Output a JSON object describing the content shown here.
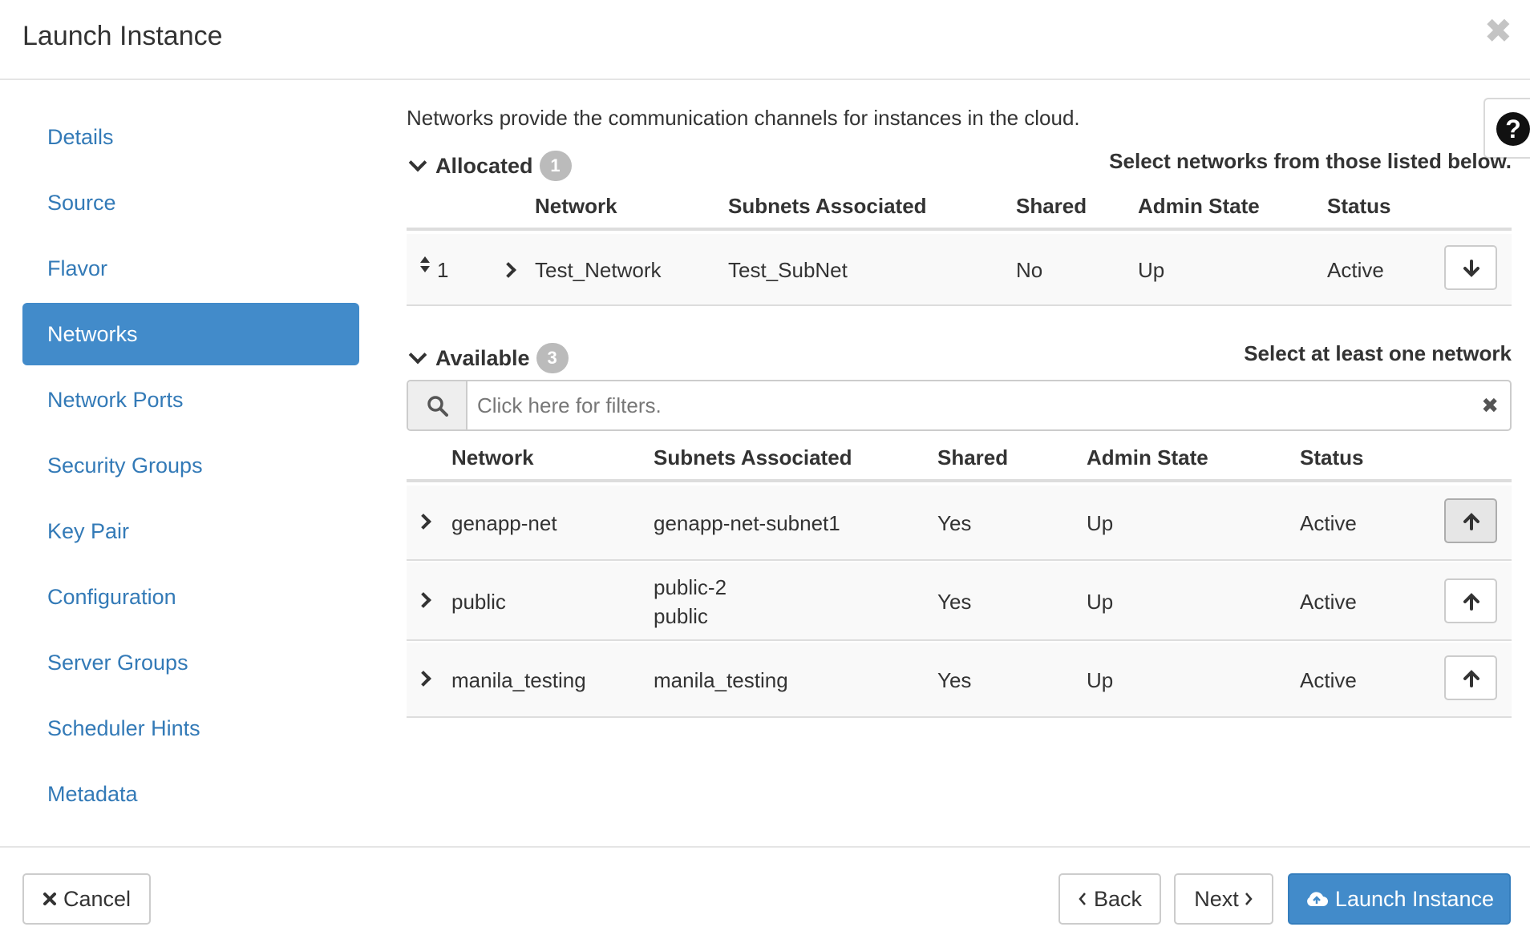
{
  "header": {
    "title": "Launch Instance",
    "close_glyph": "✖"
  },
  "sidebar": {
    "items": [
      {
        "label": "Details"
      },
      {
        "label": "Source"
      },
      {
        "label": "Flavor"
      },
      {
        "label": "Networks",
        "active": true
      },
      {
        "label": "Network Ports"
      },
      {
        "label": "Security Groups"
      },
      {
        "label": "Key Pair"
      },
      {
        "label": "Configuration"
      },
      {
        "label": "Server Groups"
      },
      {
        "label": "Scheduler Hints"
      },
      {
        "label": "Metadata"
      }
    ]
  },
  "help": {
    "glyph": "?"
  },
  "main": {
    "description": "Networks provide the communication channels for instances in the cloud.",
    "allocated": {
      "label": "Allocated",
      "count": "1",
      "hint": "Select networks from those listed below.",
      "columns": [
        "Network",
        "Subnets Associated",
        "Shared",
        "Admin State",
        "Status"
      ],
      "rows": [
        {
          "order": "1",
          "network": "Test_Network",
          "subnets": "Test_SubNet",
          "shared": "No",
          "admin_state": "Up",
          "status": "Active"
        }
      ]
    },
    "available": {
      "label": "Available",
      "count": "3",
      "hint": "Select at least one network",
      "filter_placeholder": "Click here for filters.",
      "columns": [
        "Network",
        "Subnets Associated",
        "Shared",
        "Admin State",
        "Status"
      ],
      "rows": [
        {
          "network": "genapp-net",
          "subnets": [
            "genapp-net-subnet1"
          ],
          "shared": "Yes",
          "admin_state": "Up",
          "status": "Active"
        },
        {
          "network": "public",
          "subnets": [
            "public-2",
            "public"
          ],
          "shared": "Yes",
          "admin_state": "Up",
          "status": "Active"
        },
        {
          "network": "manila_testing",
          "subnets": [
            "manila_testing"
          ],
          "shared": "Yes",
          "admin_state": "Up",
          "status": "Active"
        }
      ]
    }
  },
  "footer": {
    "cancel_label": "Cancel",
    "back_label": "Back",
    "next_label": "Next",
    "launch_label": "Launch Instance"
  },
  "colors": {
    "primary": "#428bca",
    "link": "#337ab7",
    "badge": "#bbbbbb"
  }
}
